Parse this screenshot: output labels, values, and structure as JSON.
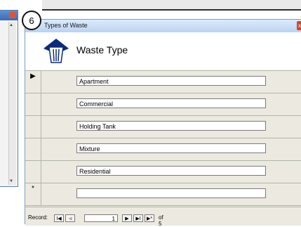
{
  "window": {
    "title": "Types of Waste",
    "close_label": "x"
  },
  "form": {
    "header_title": "Waste Type"
  },
  "records": [
    {
      "selector": "▶",
      "value": "Apartment"
    },
    {
      "selector": "",
      "value": "Commercial"
    },
    {
      "selector": "",
      "value": "Holding Tank"
    },
    {
      "selector": "",
      "value": "Mixture"
    },
    {
      "selector": "",
      "value": "Residential"
    },
    {
      "selector": "*",
      "value": ""
    }
  ],
  "navigation": {
    "label": "Record:",
    "first": "I◀",
    "prev": "◀",
    "current": "1",
    "next": "▶",
    "last": "▶I",
    "new": "▶*",
    "of_text": "of 5"
  },
  "callout": {
    "number": "6"
  },
  "icons": {
    "logo": "trash-bin-icon"
  }
}
